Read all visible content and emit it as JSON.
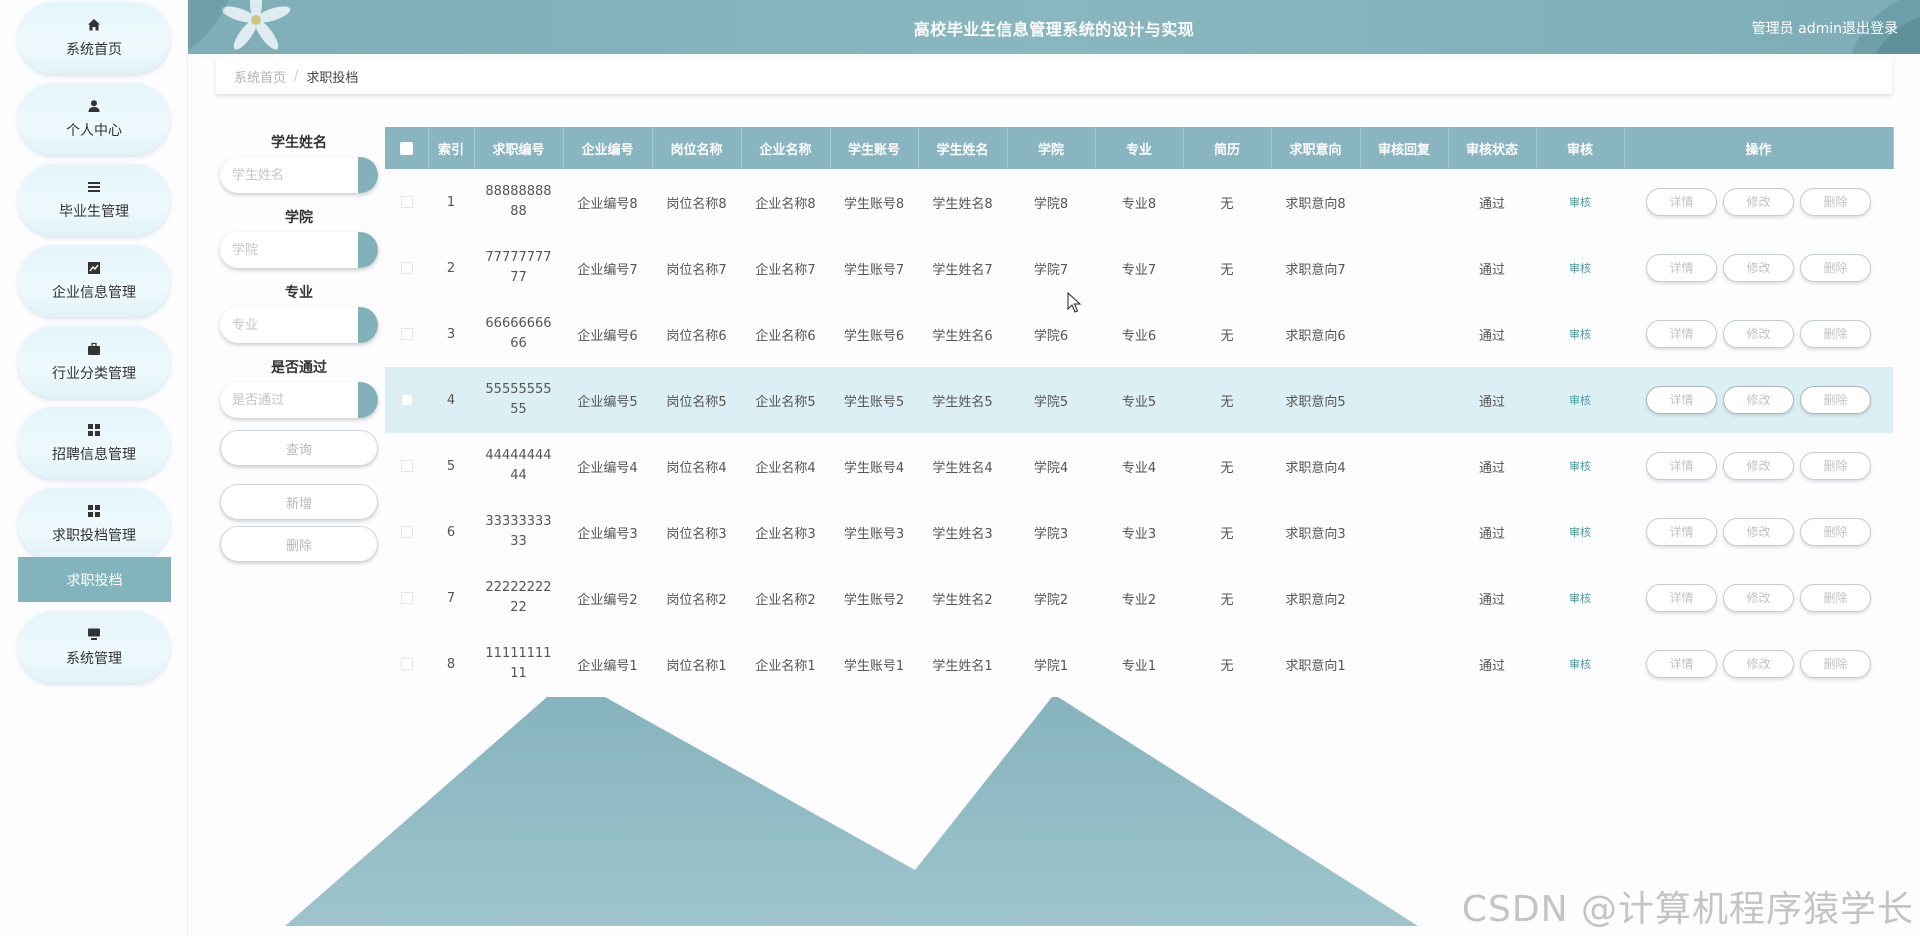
{
  "app": {
    "title": "高校毕业生信息管理系统的设计与实现",
    "user": "管理员 admin",
    "logout": "退出登录"
  },
  "sidebar": {
    "items": [
      {
        "label": "系统首页",
        "icon": "home-icon"
      },
      {
        "label": "个人中心",
        "icon": "user-icon"
      },
      {
        "label": "毕业生管理",
        "icon": "list-icon"
      },
      {
        "label": "企业信息管理",
        "icon": "chart-icon"
      },
      {
        "label": "行业分类管理",
        "icon": "briefcase-icon"
      },
      {
        "label": "招聘信息管理",
        "icon": "grid-icon"
      },
      {
        "label": "求职投档管理",
        "icon": "grid-icon"
      },
      {
        "label": "系统管理",
        "icon": "monitor-icon"
      }
    ],
    "active_sub": "求职投档"
  },
  "breadcrumb": {
    "home": "系统首页",
    "separator": "/",
    "current": "求职投档"
  },
  "search": {
    "student_name": {
      "label": "学生姓名",
      "placeholder": "学生姓名"
    },
    "college": {
      "label": "学院",
      "placeholder": "学院"
    },
    "major": {
      "label": "专业",
      "placeholder": "专业"
    },
    "passed": {
      "label": "是否通过",
      "placeholder": "是否通过"
    },
    "query_button": "查询",
    "add_button": "新增",
    "delete_button": "删除"
  },
  "table": {
    "headers": [
      "索引",
      "求职编号",
      "企业编号",
      "岗位名称",
      "企业名称",
      "学生账号",
      "学生姓名",
      "学院",
      "专业",
      "简历",
      "求职意向",
      "审核回复",
      "审核状态",
      "审核",
      "操作"
    ],
    "rows": [
      {
        "index": "1",
        "apply_no": "8888888888",
        "company_no": "企业编号8",
        "position": "岗位名称8",
        "company": "企业名称8",
        "account": "学生账号8",
        "name": "学生姓名8",
        "college": "学院8",
        "major": "专业8",
        "resume": "无",
        "intent": "求职意向8",
        "reply": "",
        "status": "通过",
        "audit": "审核"
      },
      {
        "index": "2",
        "apply_no": "7777777777",
        "company_no": "企业编号7",
        "position": "岗位名称7",
        "company": "企业名称7",
        "account": "学生账号7",
        "name": "学生姓名7",
        "college": "学院7",
        "major": "专业7",
        "resume": "无",
        "intent": "求职意向7",
        "reply": "",
        "status": "通过",
        "audit": "审核"
      },
      {
        "index": "3",
        "apply_no": "6666666666",
        "company_no": "企业编号6",
        "position": "岗位名称6",
        "company": "企业名称6",
        "account": "学生账号6",
        "name": "学生姓名6",
        "college": "学院6",
        "major": "专业6",
        "resume": "无",
        "intent": "求职意向6",
        "reply": "",
        "status": "通过",
        "audit": "审核"
      },
      {
        "index": "4",
        "apply_no": "5555555555",
        "company_no": "企业编号5",
        "position": "岗位名称5",
        "company": "企业名称5",
        "account": "学生账号5",
        "name": "学生姓名5",
        "college": "学院5",
        "major": "专业5",
        "resume": "无",
        "intent": "求职意向5",
        "reply": "",
        "status": "通过",
        "audit": "审核",
        "highlighted": true
      },
      {
        "index": "5",
        "apply_no": "4444444444",
        "company_no": "企业编号4",
        "position": "岗位名称4",
        "company": "企业名称4",
        "account": "学生账号4",
        "name": "学生姓名4",
        "college": "学院4",
        "major": "专业4",
        "resume": "无",
        "intent": "求职意向4",
        "reply": "",
        "status": "通过",
        "audit": "审核"
      },
      {
        "index": "6",
        "apply_no": "3333333333",
        "company_no": "企业编号3",
        "position": "岗位名称3",
        "company": "企业名称3",
        "account": "学生账号3",
        "name": "学生姓名3",
        "college": "学院3",
        "major": "专业3",
        "resume": "无",
        "intent": "求职意向3",
        "reply": "",
        "status": "通过",
        "audit": "审核"
      },
      {
        "index": "7",
        "apply_no": "2222222222",
        "company_no": "企业编号2",
        "position": "岗位名称2",
        "company": "企业名称2",
        "account": "学生账号2",
        "name": "学生姓名2",
        "college": "学院2",
        "major": "专业2",
        "resume": "无",
        "intent": "求职意向2",
        "reply": "",
        "status": "通过",
        "audit": "审核"
      },
      {
        "index": "8",
        "apply_no": "1111111111",
        "company_no": "企业编号1",
        "position": "岗位名称1",
        "company": "企业名称1",
        "account": "学生账号1",
        "name": "学生姓名1",
        "college": "学院1",
        "major": "专业1",
        "resume": "无",
        "intent": "求职意向1",
        "reply": "",
        "status": "通过",
        "audit": "审核"
      }
    ],
    "actions": {
      "detail": "详情",
      "edit": "修改",
      "delete": "删除"
    }
  },
  "watermark": "CSDN @计算机程序猿学长",
  "colors": {
    "accent": "#88b5bf",
    "header": "#7faeb8",
    "active_sub": "#83b3bd",
    "row_highlight": "#dceff5",
    "audit_link": "#4a9c9d",
    "mountain": "#8fbac3"
  }
}
